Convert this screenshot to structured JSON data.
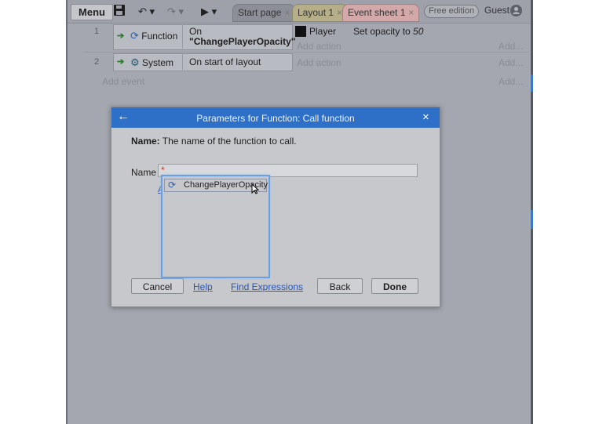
{
  "toolbar": {
    "menu_label": "Menu",
    "save_icon": "save-icon",
    "undo_icon": "↶ ▾",
    "redo_icon": "↷ ▾",
    "play_icon": "▶ ▾",
    "tabs": [
      {
        "label": "Start page",
        "close": "×"
      },
      {
        "label": "Layout 1",
        "close": "×"
      },
      {
        "label": "Event sheet 1",
        "close": "×"
      }
    ],
    "edition_badge": "Free edition",
    "user_label": "Guest"
  },
  "events": [
    {
      "number": "1",
      "object": "Function",
      "condition_line1": "On",
      "condition_line2": "\"ChangePlayerOpacity\"",
      "action_object": "Player",
      "action_text": "Set opacity to ",
      "action_value": "50",
      "add_action": "Add action",
      "add_label": "Add..."
    },
    {
      "number": "2",
      "object": "System",
      "condition_line1": "On start of layout",
      "add_action": "Add action",
      "add_label": "Add..."
    }
  ],
  "add_event": "Add event",
  "add_event_right": "Add...",
  "dialog": {
    "title": "Parameters for Function: Call function",
    "back_icon": "←",
    "close_icon": "×",
    "desc_label": "Name:",
    "desc_text": " The name of the function to call.",
    "name_label": "Name",
    "name_required": "*",
    "link_partial": "A",
    "autocomplete": [
      "ChangePlayerOpacity"
    ],
    "buttons": {
      "cancel": "Cancel",
      "help": "Help",
      "find": "Find Expressions",
      "back": "Back",
      "done": "Done"
    }
  }
}
